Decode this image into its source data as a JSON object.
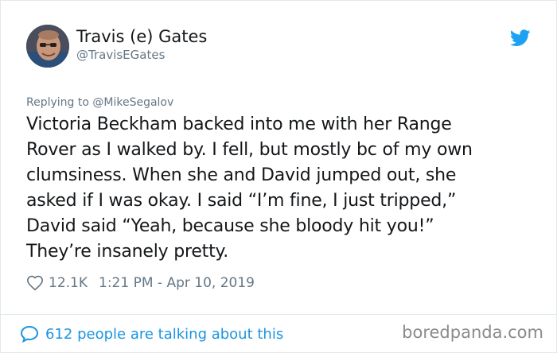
{
  "author": {
    "name": "Travis (e) Gates",
    "handle": "@TravisEGates",
    "avatar_icon": "profile-photo"
  },
  "brand_icon": "twitter-bird-icon",
  "reply": {
    "text": "Replying to @MikeSegalov"
  },
  "tweet": {
    "lines": [
      "Victoria Beckham backed into me with her Range",
      "Rover as I walked by. I fell, but mostly bc of my own",
      "clumsiness. When she and David jumped out, she",
      "asked if I was okay. I said “I’m fine, I just tripped,”",
      "David said “Yeah, because she bloody hit you!”",
      "They’re insanely pretty."
    ]
  },
  "meta": {
    "likes": "12.1K",
    "timestamp": "1:21 PM - Apr 10, 2019"
  },
  "footer": {
    "talking": "612 people are talking about this",
    "watermark": "boredpanda.com"
  },
  "colors": {
    "twitter_blue": "#1da1f2",
    "link_blue": "#1b95e0",
    "text_primary": "#14171a",
    "text_secondary": "#657786",
    "border": "#e1e8ed"
  }
}
